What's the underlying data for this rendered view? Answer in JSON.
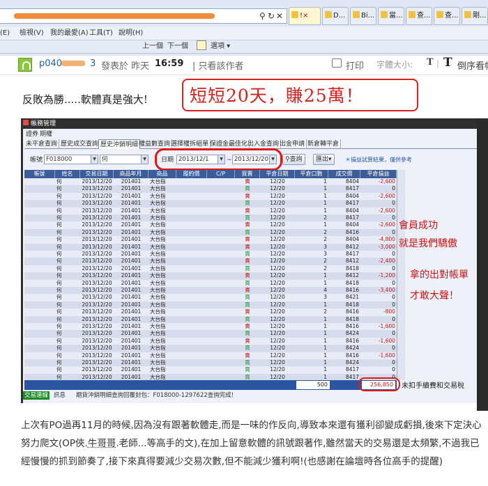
{
  "browser": {
    "addr_icons": [
      "search-icon",
      "refresh-icon",
      "close-icon"
    ],
    "tabs": [
      "D...",
      "Bi...",
      "當...",
      "查...",
      "查...",
      "剛...",
      "查..."
    ],
    "menu": [
      "(E)",
      "檢視(V)",
      "我的最愛(A)",
      "工具(T)",
      "說明(H)"
    ],
    "toolbar": {
      "prev": "上一個",
      "next": "下一個",
      "options": "選項 ▾"
    }
  },
  "post": {
    "username": "p040",
    "username_tail": "3",
    "posted": "發表於 昨天",
    "time": "16:59",
    "only_author": "| 只看該作者",
    "print": "打印",
    "font_size": "字體大小:",
    "t_small": "T",
    "t_large": "T",
    "reverse": "倒序看帖",
    "headline": "反敗為勝.....軟體真是強大!",
    "big_caption": "短短20天，賺25萬！",
    "body_parts": [
      "上次有PO過再11月的時候,因為沒有跟著軟體走,而是一味的作反向,導致本來還有獲利卻變成虧損,後來下定決心努力爬文(OP俠.",
      "牛哥哥",
      ".老師...等高手的文),在加上留意軟體的訊號跟著作,雖然當天的交易還是太頻繁,不過我已經慢慢的抓到節奏了,接下來真得要減少交易次數,但不能減少獲利啊!(也感謝在論壇時各位高手的提醒)"
    ]
  },
  "app": {
    "title": "帳務管理",
    "menu": [
      "證券",
      "期權"
    ],
    "tabs": [
      "未平倉查詢",
      "歷史成交查詢",
      "歷史沖銷明細",
      "權益數查詢",
      "選擇權拆組單",
      "保證金最佳化",
      "出入金查詢",
      "出金申請",
      "新倉轉平倉"
    ],
    "account_label": "帳號",
    "account": "F018000",
    "name_prefix": "何",
    "date_label": "日期",
    "date_from": "2013/12/1",
    "tilde": "~",
    "date_to": "2013/12/20",
    "query": "查詢",
    "export": "匯出",
    "note": "＊損益試算結果，僅供參考",
    "columns": [
      "帳號",
      "姓名",
      "交易日期",
      "商品年月",
      "商品",
      "履約價",
      "C/P",
      "買賣",
      "平倉日期",
      "平倉口數",
      "成交價",
      "平倉損益"
    ],
    "rows": [
      [
        "何",
        "2013/12/20",
        "201401",
        "大台指",
        "賣",
        "12/20",
        "1",
        "8404",
        "-2,600"
      ],
      [
        "何",
        "2013/12/20",
        "201401",
        "大台指",
        "買",
        "12/20",
        "1",
        "8417",
        "0"
      ],
      [
        "何",
        "2013/12/20",
        "201401",
        "大台指",
        "賣",
        "12/20",
        "1",
        "8404",
        "-2,600"
      ],
      [
        "何",
        "2013/12/20",
        "201401",
        "大台指",
        "買",
        "12/20",
        "1",
        "8417",
        "0"
      ],
      [
        "何",
        "2013/12/20",
        "201401",
        "大台指",
        "賣",
        "12/20",
        "1",
        "8404",
        "-2,600"
      ],
      [
        "何",
        "2013/12/20",
        "201401",
        "大台指",
        "買",
        "12/20",
        "2",
        "8417",
        "0"
      ],
      [
        "何",
        "2013/12/20",
        "201401",
        "大台指",
        "賣",
        "12/20",
        "1",
        "8404",
        "-2,600"
      ],
      [
        "何",
        "2013/12/20",
        "201401",
        "大台指",
        "買",
        "12/20",
        "2",
        "8416",
        "0"
      ],
      [
        "何",
        "2013/12/20",
        "201401",
        "大台指",
        "賣",
        "12/20",
        "2",
        "8404",
        "-4,800"
      ],
      [
        "何",
        "2013/12/20",
        "201401",
        "大台指",
        "賣",
        "12/20",
        "3",
        "8412",
        "-3,000"
      ],
      [
        "何",
        "2013/12/20",
        "201401",
        "大台指",
        "買",
        "12/20",
        "3",
        "8417",
        "0"
      ],
      [
        "何",
        "2013/12/20",
        "201401",
        "大台指",
        "賣",
        "12/20",
        "2",
        "8412",
        "-2,400"
      ],
      [
        "何",
        "2013/12/20",
        "201401",
        "大台指",
        "買",
        "12/20",
        "2",
        "8418",
        "0"
      ],
      [
        "何",
        "2013/12/20",
        "201401",
        "大台指",
        "賣",
        "12/20",
        "1",
        "8412",
        "-1,200"
      ],
      [
        "何",
        "2013/12/20",
        "201401",
        "大台指",
        "買",
        "12/20",
        "1",
        "8418",
        "0"
      ],
      [
        "何",
        "2013/12/20",
        "201401",
        "大台指",
        "賣",
        "12/20",
        "4",
        "8416",
        "-3,400"
      ],
      [
        "何",
        "2013/12/20",
        "201401",
        "大台指",
        "買",
        "12/20",
        "3",
        "8421",
        "0"
      ],
      [
        "何",
        "2013/12/20",
        "201401",
        "大台指",
        "買",
        "12/20",
        "1",
        "8418",
        "0"
      ],
      [
        "何",
        "2013/12/20",
        "201401",
        "大台指",
        "賣",
        "12/20",
        "2",
        "8416",
        "-800"
      ],
      [
        "何",
        "2013/12/20",
        "201401",
        "大台指",
        "買",
        "12/20",
        "1",
        "8418",
        "0"
      ],
      [
        "何",
        "2013/12/20",
        "201401",
        "大台指",
        "賣",
        "12/20",
        "1",
        "8416",
        "-1,600"
      ],
      [
        "何",
        "2013/12/20",
        "201401",
        "大台指",
        "買",
        "12/20",
        "1",
        "8424",
        "0"
      ],
      [
        "何",
        "2013/12/20",
        "201401",
        "大台指",
        "賣",
        "12/20",
        "1",
        "8416",
        "-1,600"
      ],
      [
        "何",
        "2013/12/20",
        "201401",
        "大台指",
        "買",
        "12/20",
        "1",
        "8424",
        "0"
      ],
      [
        "何",
        "2013/12/20",
        "201401",
        "大台指",
        "賣",
        "12/20",
        "1",
        "8416",
        "-1,600"
      ],
      [
        "何",
        "2013/12/20",
        "201401",
        "大台指",
        "買",
        "12/20",
        "1",
        "8424",
        "0"
      ],
      [
        "何",
        "2013/12/20",
        "201401",
        "大台指",
        "買",
        "12/20",
        "1",
        "8417",
        "0"
      ],
      [
        "何",
        "2013/12/20",
        "201401",
        "大台指",
        "買",
        "12/20",
        "1",
        "8417",
        "0"
      ]
    ],
    "sum_qty": "500",
    "sum_pnl": "256,850",
    "sum_note": "未扣手續費和交易稅",
    "status_green": "交易連線",
    "status_info": "訊息",
    "status_text": "期貨沖銷明細查詢回覆封包：F018000-1297622查詢完成!",
    "note1": [
      "會員成功",
      "就是我們驕傲"
    ],
    "note2": [
      "拿的出對帳單",
      "才敢大聲！"
    ]
  },
  "colors": {
    "accent_red": "#d2231e",
    "buy_green": "#0a8a1c",
    "header_blue": "#3b5e9a"
  }
}
